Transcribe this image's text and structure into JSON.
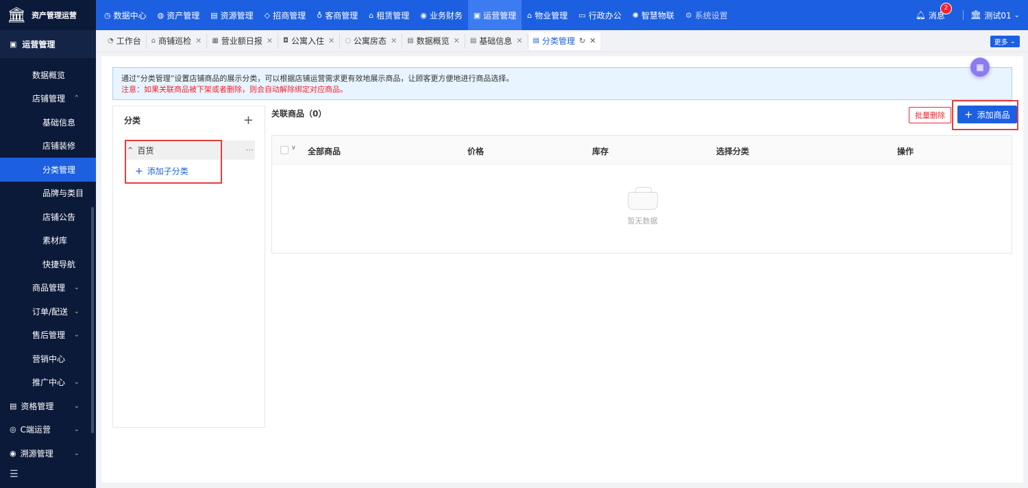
{
  "brand": {
    "logo": "bank-icon",
    "name": "资产管理运营"
  },
  "topnav": [
    {
      "label": "数据中心",
      "icon": "◷"
    },
    {
      "label": "资产管理",
      "icon": "◍"
    },
    {
      "label": "资源管理",
      "icon": "▤"
    },
    {
      "label": "招商管理",
      "icon": "◇"
    },
    {
      "label": "客商管理",
      "icon": "♁"
    },
    {
      "label": "租赁管理",
      "icon": "⌂"
    },
    {
      "label": "业务财务",
      "icon": "◉"
    },
    {
      "label": "运营管理",
      "icon": "▣"
    },
    {
      "label": "物业管理",
      "icon": "⌂"
    },
    {
      "label": "行政办公",
      "icon": "▭"
    },
    {
      "label": "智慧物联",
      "icon": "✺"
    },
    {
      "label": "系统设置",
      "icon": "⚙"
    }
  ],
  "topright": {
    "messages_label": "消息",
    "messages_count": "2",
    "user_name": "测试01"
  },
  "sidebar": {
    "title": "运营管理",
    "items": [
      {
        "label": "数据概览"
      },
      {
        "label": "店铺管理"
      },
      {
        "label": "基础信息"
      },
      {
        "label": "店铺装修"
      },
      {
        "label": "分类管理"
      },
      {
        "label": "品牌与类目"
      },
      {
        "label": "店铺公告"
      },
      {
        "label": "素材库"
      },
      {
        "label": "快捷导航"
      },
      {
        "label": "商品管理"
      },
      {
        "label": "订单/配送"
      },
      {
        "label": "售后管理"
      },
      {
        "label": "营销中心"
      },
      {
        "label": "推广中心"
      },
      {
        "label": "资格管理"
      },
      {
        "label": "C端运营"
      },
      {
        "label": "溯源管理"
      }
    ]
  },
  "tabs": [
    {
      "label": "工作台"
    },
    {
      "label": "商铺巡检"
    },
    {
      "label": "营业额日报"
    },
    {
      "label": "公寓入住"
    },
    {
      "label": "公寓房态"
    },
    {
      "label": "数据概览"
    },
    {
      "label": "基础信息"
    },
    {
      "label": "分类管理"
    }
  ],
  "more_label": "更多",
  "notice": {
    "line1": "通过“分类管理”设置店铺商品的展示分类，可以根据店铺运营需求更有效地展示商品，让顾客更方便地进行商品选择。",
    "line2": "注意：如果关联商品被下架或者删除，则会自动解除绑定对应商品。"
  },
  "category": {
    "title": "分类",
    "node": "百货",
    "add_sub": "添加子分类"
  },
  "goods": {
    "title": "关联商品（0）",
    "batch_delete": "批量删除",
    "add": "添加商品",
    "columns": [
      "全部商品",
      "价格",
      "库存",
      "选择分类",
      "操作"
    ],
    "empty": "暂无数据"
  },
  "colors": {
    "primary": "#1c5fe0",
    "sidebar": "#0c1a3a",
    "danger": "#f5222d"
  }
}
